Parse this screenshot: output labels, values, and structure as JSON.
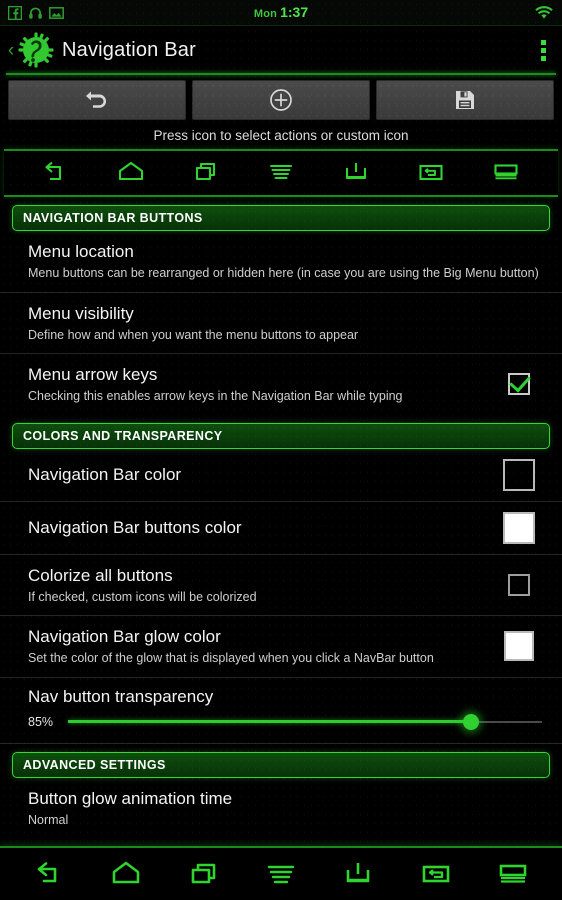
{
  "statusbar": {
    "icons_left": [
      "facebook-icon",
      "headphones-icon",
      "image-icon"
    ],
    "day": "Mon",
    "time": "1:37",
    "icons_right": [
      "wifi-icon"
    ]
  },
  "titlebar": {
    "back_label": "‹",
    "app_icon": "gear-app-icon",
    "title": "Navigation Bar",
    "overflow_label": "overflow-menu"
  },
  "toolbar": {
    "buttons": [
      {
        "name": "revert-button",
        "icon": "undo-arrow-icon"
      },
      {
        "name": "add-button",
        "icon": "plus-circle-icon"
      },
      {
        "name": "save-button",
        "icon": "floppy-disk-icon"
      }
    ],
    "hint": "Press icon to select actions or custom icon"
  },
  "nav_preview": {
    "icons": [
      "back-arrow-icon",
      "home-icon",
      "recents-icon",
      "menu-lines-icon",
      "keyboard-hide-icon",
      "ime-switcher-icon",
      "expand-desktop-icon"
    ]
  },
  "sections": [
    {
      "header": "NAVIGATION BAR BUTTONS",
      "items": [
        {
          "name": "menu-location",
          "title": "Menu location",
          "sub": "Menu buttons can be rearranged or hidden here (in case you are using the Big Menu button)",
          "control": "none"
        },
        {
          "name": "menu-visibility",
          "title": "Menu visibility",
          "sub": "Define how and when you want the menu buttons to appear",
          "control": "none"
        },
        {
          "name": "menu-arrow-keys",
          "title": "Menu arrow keys",
          "sub": "Checking this enables arrow keys in the Navigation Bar while typing",
          "control": "checkbox",
          "checked": true
        }
      ]
    },
    {
      "header": "COLORS AND TRANSPARENCY",
      "items": [
        {
          "name": "navigation-bar-color",
          "title": "Navigation Bar color",
          "sub": "",
          "control": "swatch",
          "swatch_color": "#000000"
        },
        {
          "name": "navigation-bar-buttons-color",
          "title": "Navigation Bar buttons color",
          "sub": "",
          "control": "swatch",
          "swatch_color": "#ffffff"
        },
        {
          "name": "colorize-all-buttons",
          "title": "Colorize all buttons",
          "sub": "If checked, custom icons will be colorized",
          "control": "checkbox",
          "checked": false
        },
        {
          "name": "navigation-bar-glow-color",
          "title": "Navigation Bar glow color",
          "sub": "Set the color of the glow that is displayed when you click a NavBar button",
          "control": "swatch",
          "swatch_color": "#ffffff"
        }
      ]
    }
  ],
  "transparency": {
    "name": "nav-button-transparency",
    "title": "Nav button transparency",
    "value_label": "85%",
    "value": 85
  },
  "advanced": {
    "header": "ADVANCED SETTINGS",
    "items": [
      {
        "name": "button-glow-animation-time",
        "title": "Button glow animation time",
        "sub": "Normal"
      }
    ]
  },
  "bottom_nav": {
    "icons": [
      "back-arrow-icon",
      "home-icon",
      "recents-icon",
      "menu-lines-icon",
      "keyboard-hide-icon",
      "ime-switcher-icon",
      "expand-desktop-icon"
    ]
  },
  "theme": {
    "accent_green": "#3ad23a",
    "header_green_bg": "#0d4f0d",
    "text_primary": "#f4f4f4",
    "text_secondary": "#cfcfcf",
    "background": "#000000"
  }
}
